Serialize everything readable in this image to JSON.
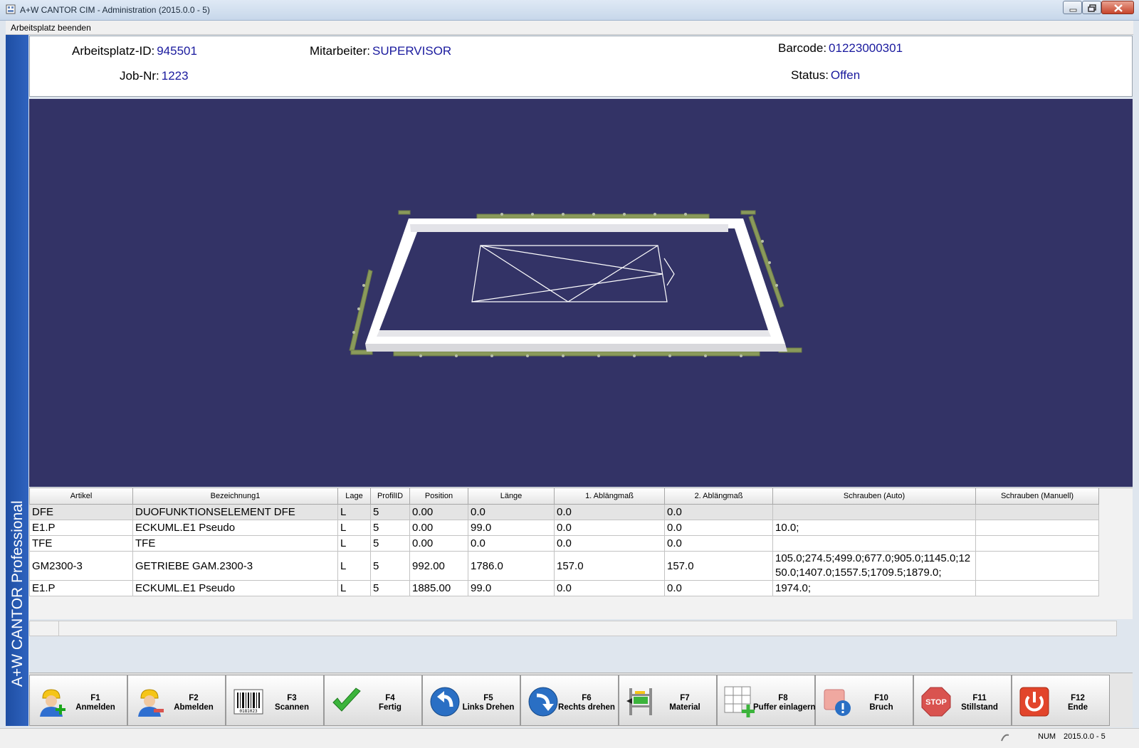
{
  "window": {
    "title": "A+W CANTOR CIM - Administration (2015.0.0 - 5)"
  },
  "menu": {
    "item1": "Arbeitsplatz beenden"
  },
  "sidebar": {
    "brand": "A+W CANTOR Professional"
  },
  "info": {
    "workstation_label": "Arbeitsplatz-ID:",
    "workstation_value": "945501",
    "job_label": "Job-Nr:",
    "job_value": "1223",
    "employee_label": "Mitarbeiter:",
    "employee_value": "SUPERVISOR",
    "barcode_label": "Barcode:",
    "barcode_value": "01223000301",
    "status_label": "Status:",
    "status_value": "Offen"
  },
  "colors": {
    "viewport_bg": "#333366",
    "value_text": "#1a1a9e",
    "profile": "#8a9a5b"
  },
  "table": {
    "headers": [
      "Artikel",
      "Bezeichnung1",
      "Lage",
      "ProfilID",
      "Position",
      "Länge",
      "1. Ablängmaß",
      "2. Ablängmaß",
      "Schrauben (Auto)",
      "Schrauben (Manuell)"
    ],
    "rows": [
      [
        "DFE",
        "DUOFUNKTIONSELEMENT DFE",
        "L",
        "5",
        "0.00",
        "0.0",
        "0.0",
        "0.0",
        "",
        ""
      ],
      [
        "E1.P",
        "ECKUML.E1 Pseudo",
        "L",
        "5",
        "0.00",
        "99.0",
        "0.0",
        "0.0",
        "10.0;",
        ""
      ],
      [
        "TFE",
        "TFE",
        "L",
        "5",
        "0.00",
        "0.0",
        "0.0",
        "0.0",
        "",
        ""
      ],
      [
        "GM2300-3",
        "GETRIEBE GAM.2300-3",
        "L",
        "5",
        "992.00",
        "1786.0",
        "157.0",
        "157.0",
        "105.0;274.5;499.0;677.0;905.0;1145.0;1250.0;1407.0;1557.5;1709.5;1879.0;",
        ""
      ],
      [
        "E1.P",
        "ECKUML.E1 Pseudo",
        "L",
        "5",
        "1885.00",
        "99.0",
        "0.0",
        "0.0",
        "1974.0;",
        ""
      ]
    ]
  },
  "toolbar": {
    "f1_key": "F1",
    "f1_label": "Anmelden",
    "f2_key": "F2",
    "f2_label": "Abmelden",
    "f3_key": "F3",
    "f3_label": "Scannen",
    "f4_key": "F4",
    "f4_label": "Fertig",
    "f5_key": "F5",
    "f5_label": "Links Drehen",
    "f6_key": "F6",
    "f6_label": "Rechts drehen",
    "f7_key": "F7",
    "f7_label": "Material",
    "f8_key": "F8",
    "f8_label": "Puffer einlagern",
    "f10_key": "F10",
    "f10_label": "Bruch",
    "f11_key": "F11",
    "f11_label": "Stillstand",
    "f12_key": "F12",
    "f12_label": "Ende"
  },
  "icons": {
    "barcode_digits": "0181023",
    "stop_text": "STOP"
  },
  "statusbar": {
    "num": "NUM",
    "version": "2015.0.0 - 5"
  }
}
